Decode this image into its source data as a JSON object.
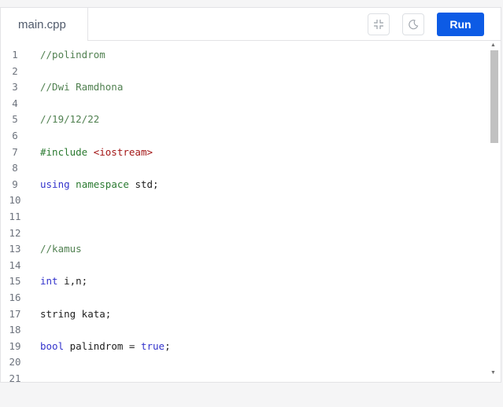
{
  "tab": {
    "label": "main.cpp"
  },
  "toolbar": {
    "collapse_icon": "collapse-icon",
    "theme_icon": "moon-icon",
    "run_label": "Run"
  },
  "colors": {
    "run_button": "#0d5be5",
    "comment": "#508050",
    "keyword": "#3333cc",
    "string": "#a31515"
  },
  "code": {
    "lines": [
      {
        "n": "1",
        "parts": [
          {
            "t": "//polindrom",
            "c": "cm"
          }
        ]
      },
      {
        "n": "2",
        "parts": []
      },
      {
        "n": "3",
        "parts": [
          {
            "t": "//Dwi Ramdhona",
            "c": "cm"
          }
        ]
      },
      {
        "n": "4",
        "parts": []
      },
      {
        "n": "5",
        "parts": [
          {
            "t": "//19/12/22",
            "c": "cm"
          }
        ]
      },
      {
        "n": "6",
        "parts": []
      },
      {
        "n": "7",
        "parts": [
          {
            "t": "#include ",
            "c": "pp"
          },
          {
            "t": "<iostream>",
            "c": "str"
          }
        ]
      },
      {
        "n": "8",
        "parts": []
      },
      {
        "n": "9",
        "parts": [
          {
            "t": "using",
            "c": "kw"
          },
          {
            "t": " namespace ",
            "c": "pp"
          },
          {
            "t": "std;",
            "c": ""
          }
        ]
      },
      {
        "n": "10",
        "parts": []
      },
      {
        "n": "11",
        "parts": []
      },
      {
        "n": "12",
        "parts": []
      },
      {
        "n": "13",
        "parts": [
          {
            "t": "//kamus",
            "c": "cm"
          }
        ]
      },
      {
        "n": "14",
        "parts": []
      },
      {
        "n": "15",
        "parts": [
          {
            "t": "int",
            "c": "kw"
          },
          {
            "t": " i,n;",
            "c": ""
          }
        ]
      },
      {
        "n": "16",
        "parts": []
      },
      {
        "n": "17",
        "parts": [
          {
            "t": "string kata;",
            "c": ""
          }
        ]
      },
      {
        "n": "18",
        "parts": []
      },
      {
        "n": "19",
        "parts": [
          {
            "t": "bool",
            "c": "kw"
          },
          {
            "t": " palindrom = ",
            "c": ""
          },
          {
            "t": "true",
            "c": "kw"
          },
          {
            "t": ";",
            "c": ""
          }
        ]
      },
      {
        "n": "20",
        "parts": []
      },
      {
        "n": "21",
        "parts": []
      }
    ]
  }
}
